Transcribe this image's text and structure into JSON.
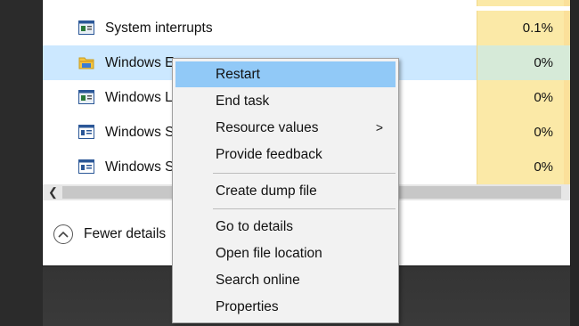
{
  "process_rows": [
    {
      "name": "System interrupts",
      "cpu": "0.1%",
      "icon": "system-process-icon"
    },
    {
      "name": "Windows Explorer",
      "cpu": "0%",
      "icon": "folder-icon",
      "selected": true
    },
    {
      "name": "Windows Logon Application",
      "cpu": "0%",
      "icon": "system-process-icon"
    },
    {
      "name": "Windows Session Manager",
      "cpu": "0%",
      "icon": "window-app-icon"
    },
    {
      "name": "Windows Start-Up Application",
      "cpu": "0%",
      "icon": "window-app-icon"
    }
  ],
  "visible_labels": {
    "row0": "System interrupts",
    "row1": "Windows E",
    "row2": "Windows L",
    "row3": "Windows S",
    "row4": "Windows S"
  },
  "footer": {
    "fewer_details": "Fewer details"
  },
  "context_menu": {
    "restart": "Restart",
    "end_task": "End task",
    "resource_values": "Resource values",
    "provide_feedback": "Provide feedback",
    "create_dump_file": "Create dump file",
    "go_to_details": "Go to details",
    "open_file_location": "Open file location",
    "search_online": "Search online",
    "properties": "Properties",
    "submenu_arrow": ">"
  },
  "colors": {
    "selection": "#cce8ff",
    "highlight": "#91c9f7",
    "cpu_heat": "#fbe9a7"
  }
}
